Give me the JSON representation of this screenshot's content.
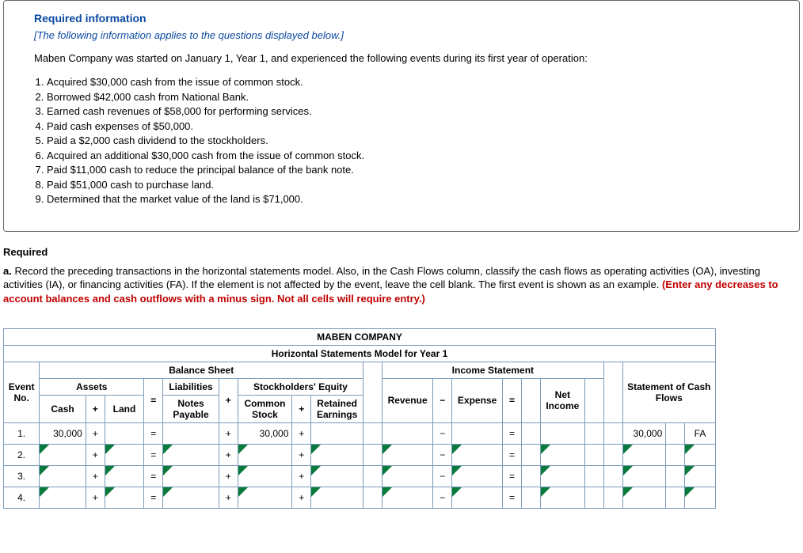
{
  "info": {
    "title": "Required information",
    "subtitle": "[The following information applies to the questions displayed below.]",
    "intro": "Maben Company was started on January 1, Year 1, and experienced the following events during its first year of operation:",
    "events": [
      "Acquired $30,000 cash from the issue of common stock.",
      "Borrowed $42,000 cash from National Bank.",
      "Earned cash revenues of $58,000 for performing services.",
      "Paid cash expenses of $50,000.",
      "Paid a $2,000 cash dividend to the stockholders.",
      "Acquired an additional $30,000 cash from the issue of common stock.",
      "Paid $11,000 cash to reduce the principal balance of the bank note.",
      "Paid $51,000 cash to purchase land.",
      "Determined that the market value of the land is $71,000."
    ]
  },
  "required": {
    "heading": "Required",
    "label": "a.",
    "body": "Record the preceding transactions in the horizontal statements model. Also, in the Cash Flows column, classify the cash flows as operating activities (OA), investing activities (IA), or financing activities (FA). If the element is not affected by the event, leave the cell blank. The first event is shown as an example. ",
    "note": "(Enter any decreases to account balances and cash outflows with a minus sign. Not all cells will require entry.)"
  },
  "table": {
    "title": "MABEN COMPANY",
    "subtitle": "Horizontal Statements Model for Year 1",
    "bs": "Balance Sheet",
    "is": "Income Statement",
    "event_no": "Event No.",
    "assets": "Assets",
    "liab": "Liabilities",
    "se": "Stockholders' Equity",
    "scf": "Statement of Cash Flows",
    "cash": "Cash",
    "land": "Land",
    "notes": "Notes Payable",
    "common": "Common Stock",
    "retained": "Retained Earnings",
    "revenue": "Revenue",
    "expense": "Expense",
    "ni": "Net Income",
    "rows": [
      {
        "n": "1.",
        "cash": "30,000",
        "common": "30,000",
        "scf_num": "30,000",
        "scf_type": "FA"
      },
      {
        "n": "2."
      },
      {
        "n": "3."
      },
      {
        "n": "4."
      }
    ]
  }
}
